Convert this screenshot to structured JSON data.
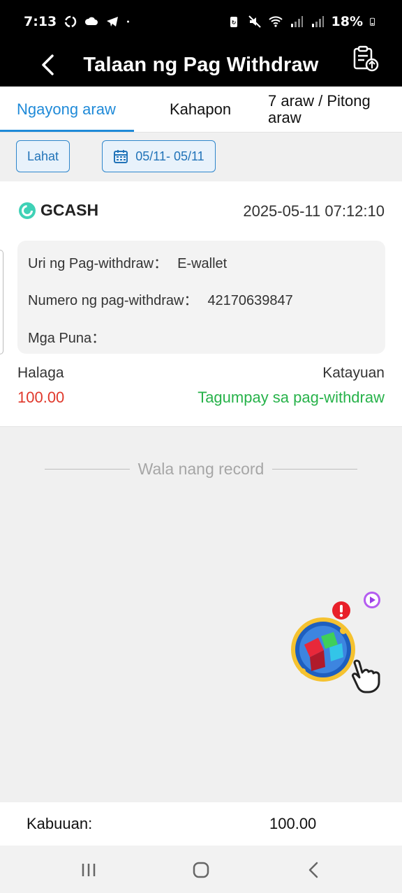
{
  "status_bar": {
    "time": "7:13",
    "battery": "18%",
    "icons": [
      "sync-icon",
      "cloud-icon",
      "telegram-icon",
      "dot-icon",
      "battery-saver-icon",
      "mute-icon",
      "wifi-icon",
      "signal-icon",
      "signal-icon",
      "battery-icon"
    ]
  },
  "header": {
    "title": "Talaan ng Pag Withdraw",
    "back_icon": "chevron-left-icon",
    "action_icon": "clipboard-upload-icon"
  },
  "tabs": [
    {
      "label": "Ngayong araw",
      "active": true
    },
    {
      "label": "Kahapon",
      "active": false
    },
    {
      "label": "7 araw / Pitong araw",
      "active": false
    }
  ],
  "filters": {
    "all_label": "Lahat",
    "date_range": "05/11- 05/11",
    "calendar_icon": "calendar-icon"
  },
  "record": {
    "method": "GCASH",
    "datetime": "2025-05-11 07:12:10",
    "type_label": "Uri ng Pag-withdraw：",
    "type_value": "E-wallet",
    "number_label": "Numero ng pag-withdraw：",
    "number_value": "42170639847",
    "remarks_label": "Mga Puna：",
    "remarks_value": "",
    "amount_label": "Halaga",
    "amount_value": "100.00",
    "status_label": "Katayuan",
    "status_value": "Tagumpay sa pag-withdraw"
  },
  "empty_text": "Wala nang record",
  "footer": {
    "total_label": "Kabuuan:",
    "total_value": "100.00"
  },
  "colors": {
    "accent": "#1f8ad8",
    "amount": "#e0382b",
    "success": "#27b24a",
    "header_bg": "#000000"
  }
}
